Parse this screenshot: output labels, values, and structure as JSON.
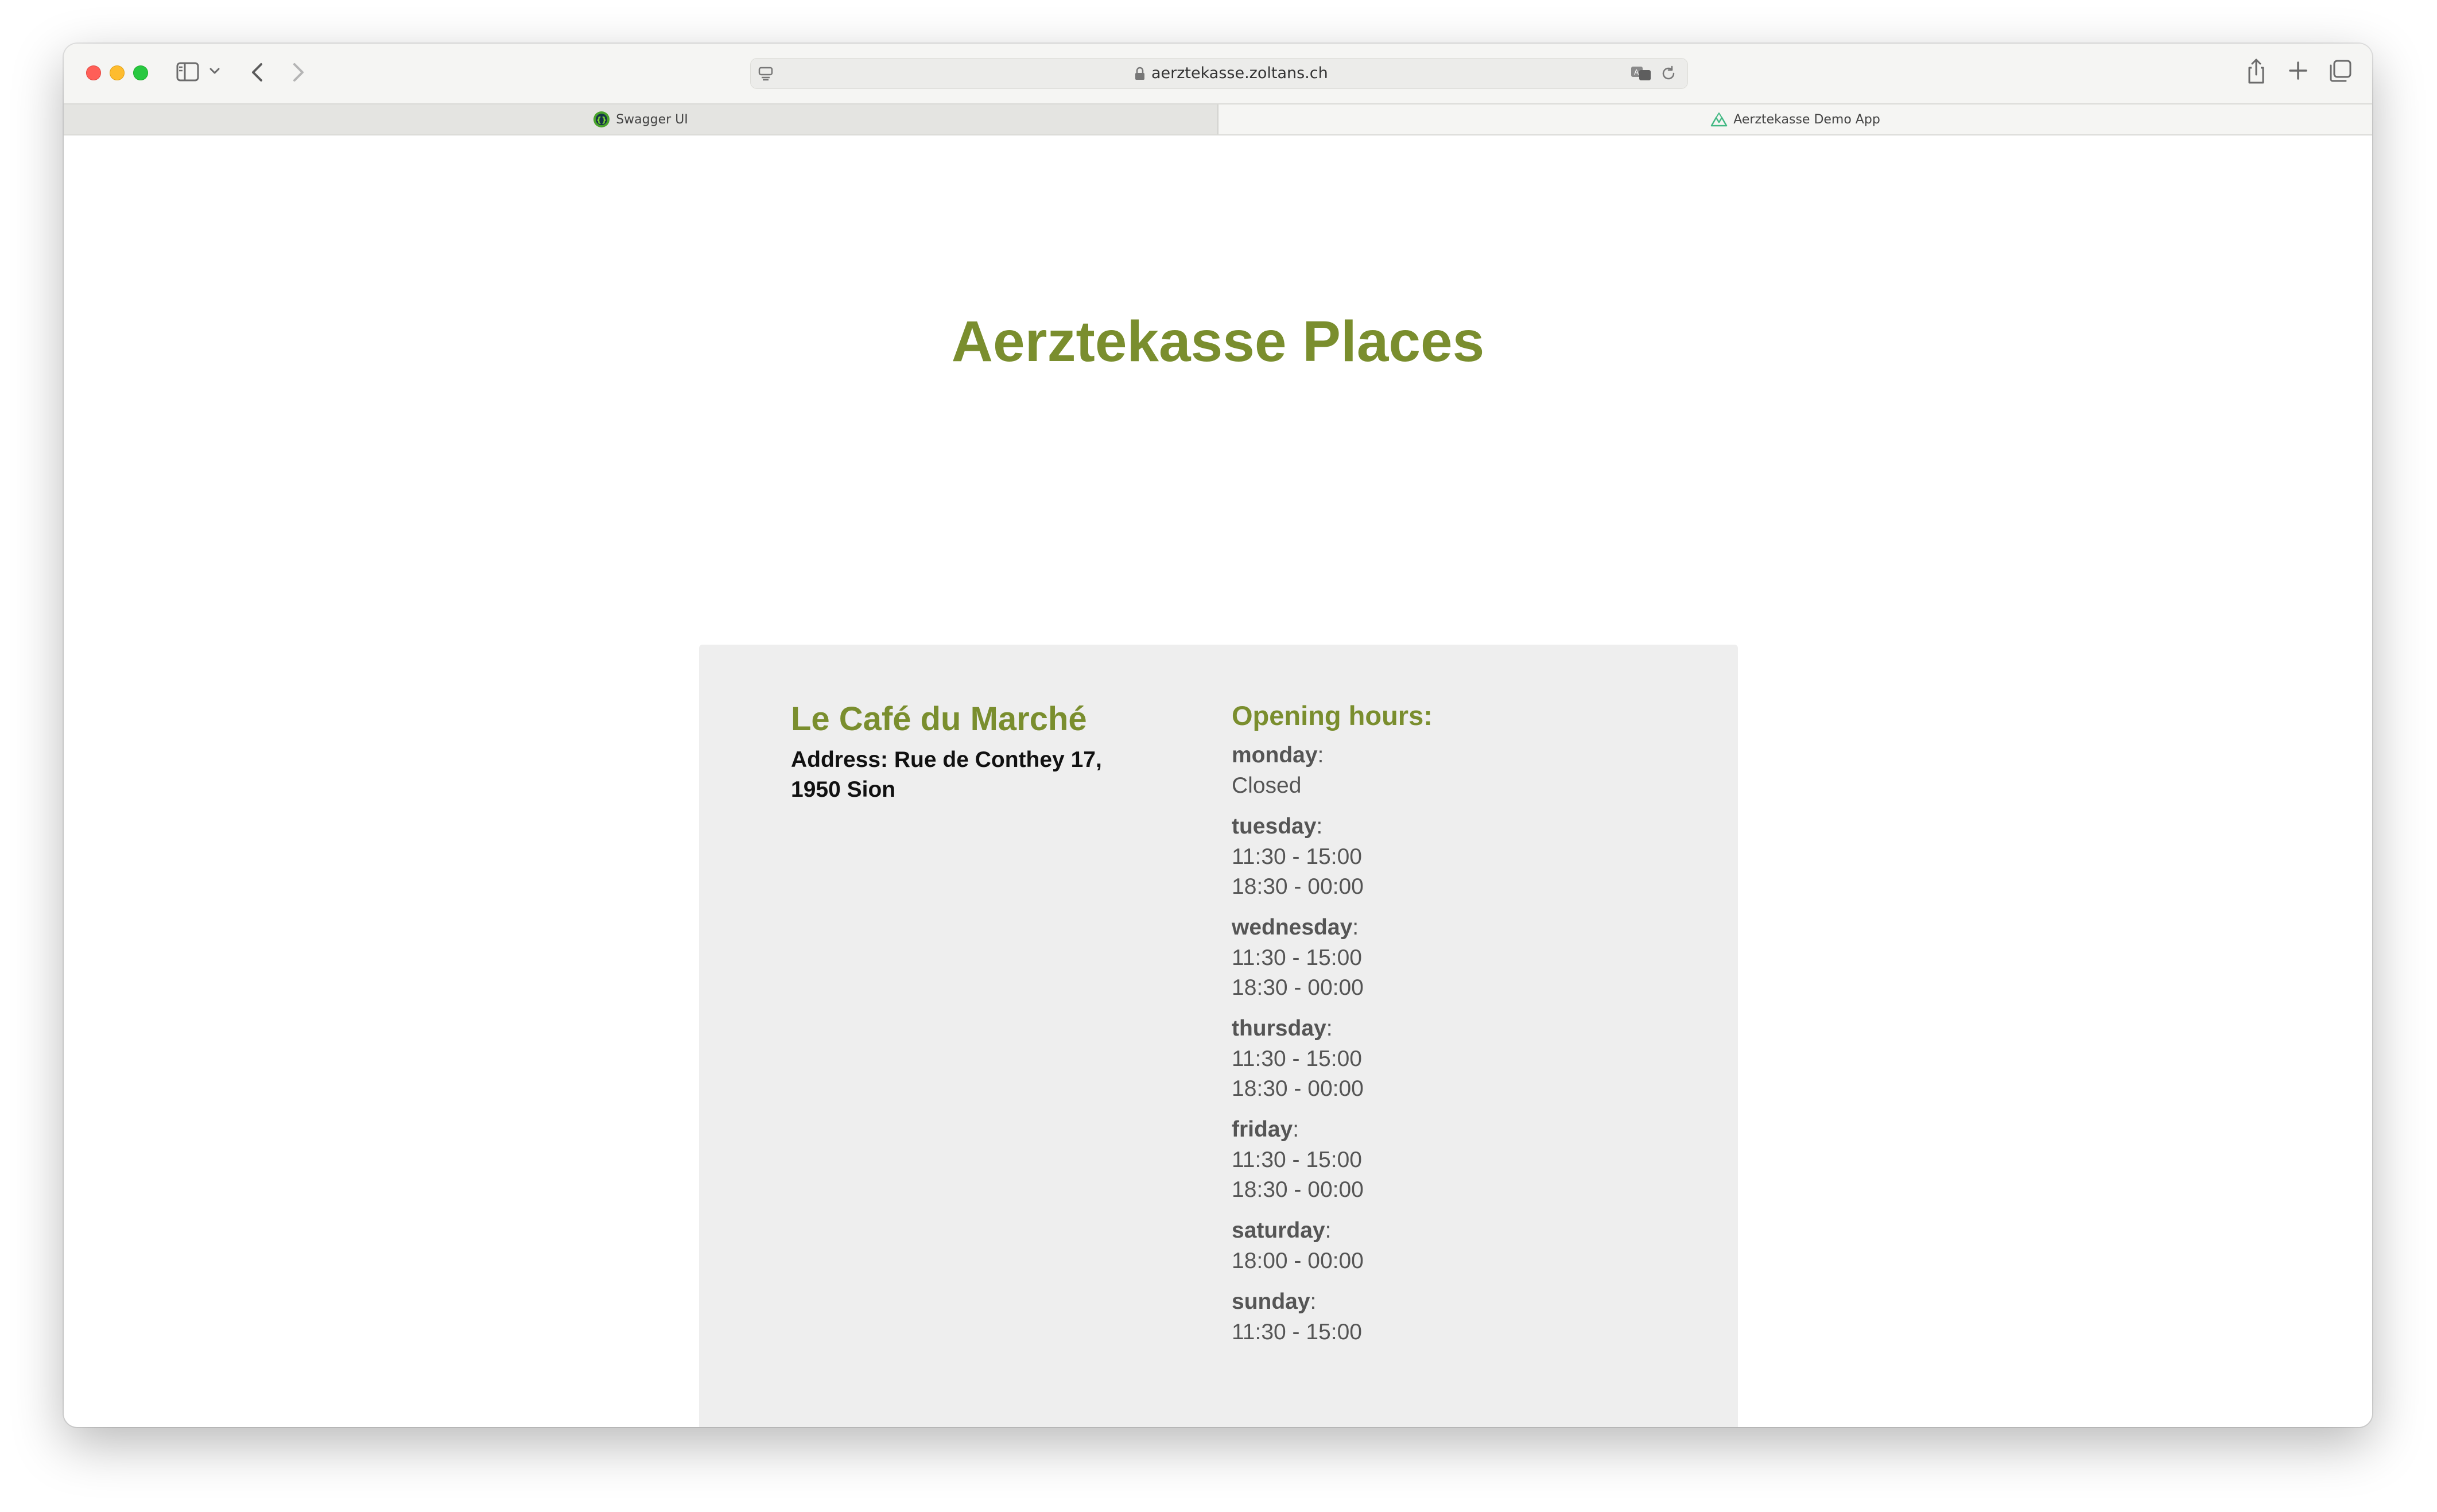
{
  "browser": {
    "url": "aerztekasse.zoltans.ch",
    "tabs": [
      {
        "label": "Swagger UI",
        "icon": "swagger-icon",
        "active": false
      },
      {
        "label": "Aerztekasse Demo App",
        "icon": "vue-icon",
        "active": true
      }
    ],
    "tab_close_glyph": "×"
  },
  "page": {
    "title": "Aerztekasse Places",
    "accent_color": "#7a8e2e",
    "card_background": "#eeeeee"
  },
  "place": {
    "name": "Le Café du Marché",
    "address": "Address: Rue de Conthey 17, 1950 Sion"
  },
  "opening_hours": {
    "title": "Opening hours:",
    "days": [
      {
        "day": "monday",
        "slots": [
          "Closed"
        ]
      },
      {
        "day": "tuesday",
        "slots": [
          "11:30 - 15:00",
          "18:30 - 00:00"
        ]
      },
      {
        "day": "wednesday",
        "slots": [
          "11:30 - 15:00",
          "18:30 - 00:00"
        ]
      },
      {
        "day": "thursday",
        "slots": [
          "11:30 - 15:00",
          "18:30 - 00:00"
        ]
      },
      {
        "day": "friday",
        "slots": [
          "11:30 - 15:00",
          "18:30 - 00:00"
        ]
      },
      {
        "day": "saturday",
        "slots": [
          "18:00 - 00:00"
        ]
      },
      {
        "day": "sunday",
        "slots": [
          "11:30 - 15:00"
        ]
      }
    ]
  }
}
